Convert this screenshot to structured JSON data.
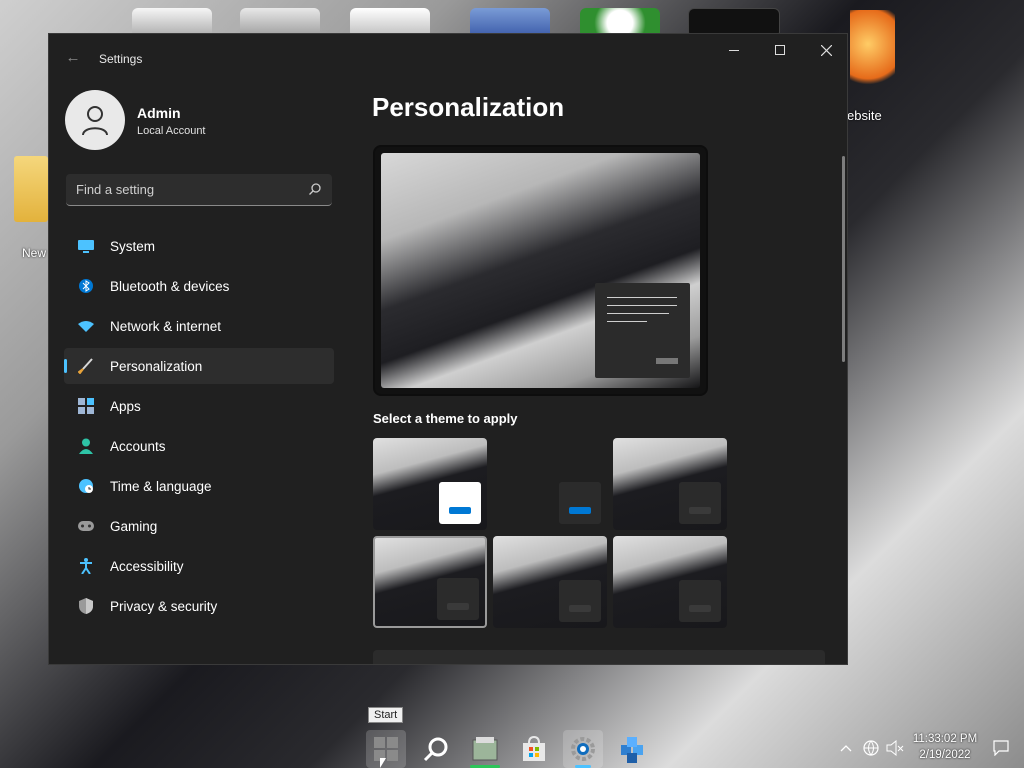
{
  "desktop": {
    "left_folder_label": "New",
    "right_shortcut_label": "ebsite"
  },
  "window": {
    "title": "Settings",
    "back_icon": "back-arrow-icon",
    "controls": {
      "minimize": "minimize-icon",
      "maximize": "maximize-icon",
      "close": "close-icon"
    }
  },
  "user": {
    "name": "Admin",
    "account_type": "Local Account",
    "avatar_icon": "person-icon"
  },
  "search": {
    "placeholder": "Find a setting",
    "icon": "search-icon"
  },
  "nav": {
    "items": [
      {
        "label": "System",
        "icon": "monitor-icon",
        "color": "#4cc2ff",
        "active": false
      },
      {
        "label": "Bluetooth & devices",
        "icon": "bluetooth-icon",
        "color": "#0078d4",
        "active": false
      },
      {
        "label": "Network & internet",
        "icon": "wifi-icon",
        "color": "#4cc2ff",
        "active": false
      },
      {
        "label": "Personalization",
        "icon": "brush-icon",
        "color": "#e8a33a",
        "active": true
      },
      {
        "label": "Apps",
        "icon": "apps-icon",
        "color": "#9fb7d6",
        "active": false
      },
      {
        "label": "Accounts",
        "icon": "person-icon",
        "color": "#2ec4a7",
        "active": false
      },
      {
        "label": "Time & language",
        "icon": "globe-clock-icon",
        "color": "#4cc2ff",
        "active": false
      },
      {
        "label": "Gaming",
        "icon": "gamepad-icon",
        "color": "#9a9a9a",
        "active": false
      },
      {
        "label": "Accessibility",
        "icon": "accessibility-icon",
        "color": "#4cc2ff",
        "active": false
      },
      {
        "label": "Privacy & security",
        "icon": "shield-icon",
        "color": "#9a9a9a",
        "active": false
      }
    ]
  },
  "main": {
    "title": "Personalization",
    "theme_heading": "Select a theme to apply",
    "themes": [
      {
        "name": "theme-light",
        "style": "light",
        "selected": false
      },
      {
        "name": "theme-dark-blank",
        "style": "dark-blank",
        "selected": false
      },
      {
        "name": "theme-dark-1",
        "style": "dark",
        "selected": false
      },
      {
        "name": "theme-dark-2",
        "style": "dark",
        "selected": true
      },
      {
        "name": "theme-dark-3",
        "style": "dark",
        "selected": false
      },
      {
        "name": "theme-dark-4",
        "style": "dark",
        "selected": false
      }
    ]
  },
  "taskbar": {
    "tooltip": "Start",
    "apps": [
      {
        "name": "start-button",
        "icon": "windows-logo-icon",
        "running": true
      },
      {
        "name": "search-button",
        "icon": "search-icon",
        "running": false
      },
      {
        "name": "file-explorer-button",
        "icon": "folder-icon",
        "running": false
      },
      {
        "name": "store-button",
        "icon": "store-icon",
        "running": false
      },
      {
        "name": "settings-button",
        "icon": "gear-icon",
        "running": true
      },
      {
        "name": "registry-button",
        "icon": "cubes-icon",
        "running": false
      }
    ],
    "tray": {
      "chevron_icon": "chevron-up-icon",
      "network_icon": "globe-icon",
      "volume_icon": "speaker-muted-icon",
      "notification_icon": "notification-icon"
    },
    "time": "11:33:02 PM",
    "date": "2/19/2022"
  },
  "colors": {
    "accent": "#4cc2ff",
    "window_bg": "#202020",
    "selected_nav_bg": "#2d2d2d",
    "theme_blue": "#0078d4"
  }
}
